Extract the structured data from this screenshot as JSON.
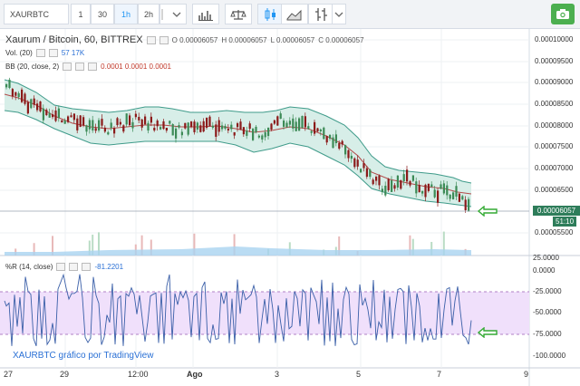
{
  "toolbar": {
    "symbol": "XAURBTC",
    "intervals": [
      "1",
      "30",
      "1h",
      "2h"
    ],
    "active_interval": "1h"
  },
  "legend": {
    "title": "Xaurum / Bitcoin, 60, BITTREX",
    "ohlc_o": "O 0.00006057",
    "ohlc_h": "H 0.00006057",
    "ohlc_l": "L 0.00006057",
    "ohlc_c": "C 0.00006057",
    "vol_label": "Vol. (20)",
    "vol_values": "57  17K",
    "bb_label": "BB (20, close, 2)",
    "bb_values": "0.0001  0.0001  0.0001",
    "wr_label": "%R (14, close)",
    "wr_value": "-81.2201"
  },
  "price_axis": [
    "0.00010000",
    "0.00009500",
    "0.00009000",
    "0.00008500",
    "0.00008000",
    "0.00007500",
    "0.00007000",
    "0.00006500",
    "0.00006057",
    "0.00005500"
  ],
  "current_price": "0.00006057",
  "countdown": "51:10",
  "wr_axis": [
    "25.0000",
    "0.0000",
    "-25.0000",
    "-50.0000",
    "-75.0000",
    "-100.0000",
    "-125.0000"
  ],
  "time_axis": [
    "27",
    "29",
    "12:00",
    "Ago",
    "3",
    "5",
    "7",
    "9"
  ],
  "watermark": "XAURBTC gráfico por TradingView",
  "colors": {
    "up": "#3c8a56",
    "down": "#8b1a1a",
    "band_fill": "#d7eee8",
    "band_line": "#3f9b8a",
    "basis": "#b34a4a",
    "wr_zone": "#f0e0fb",
    "wr_line": "#3a5fa8",
    "accent": "#2196f3"
  }
}
